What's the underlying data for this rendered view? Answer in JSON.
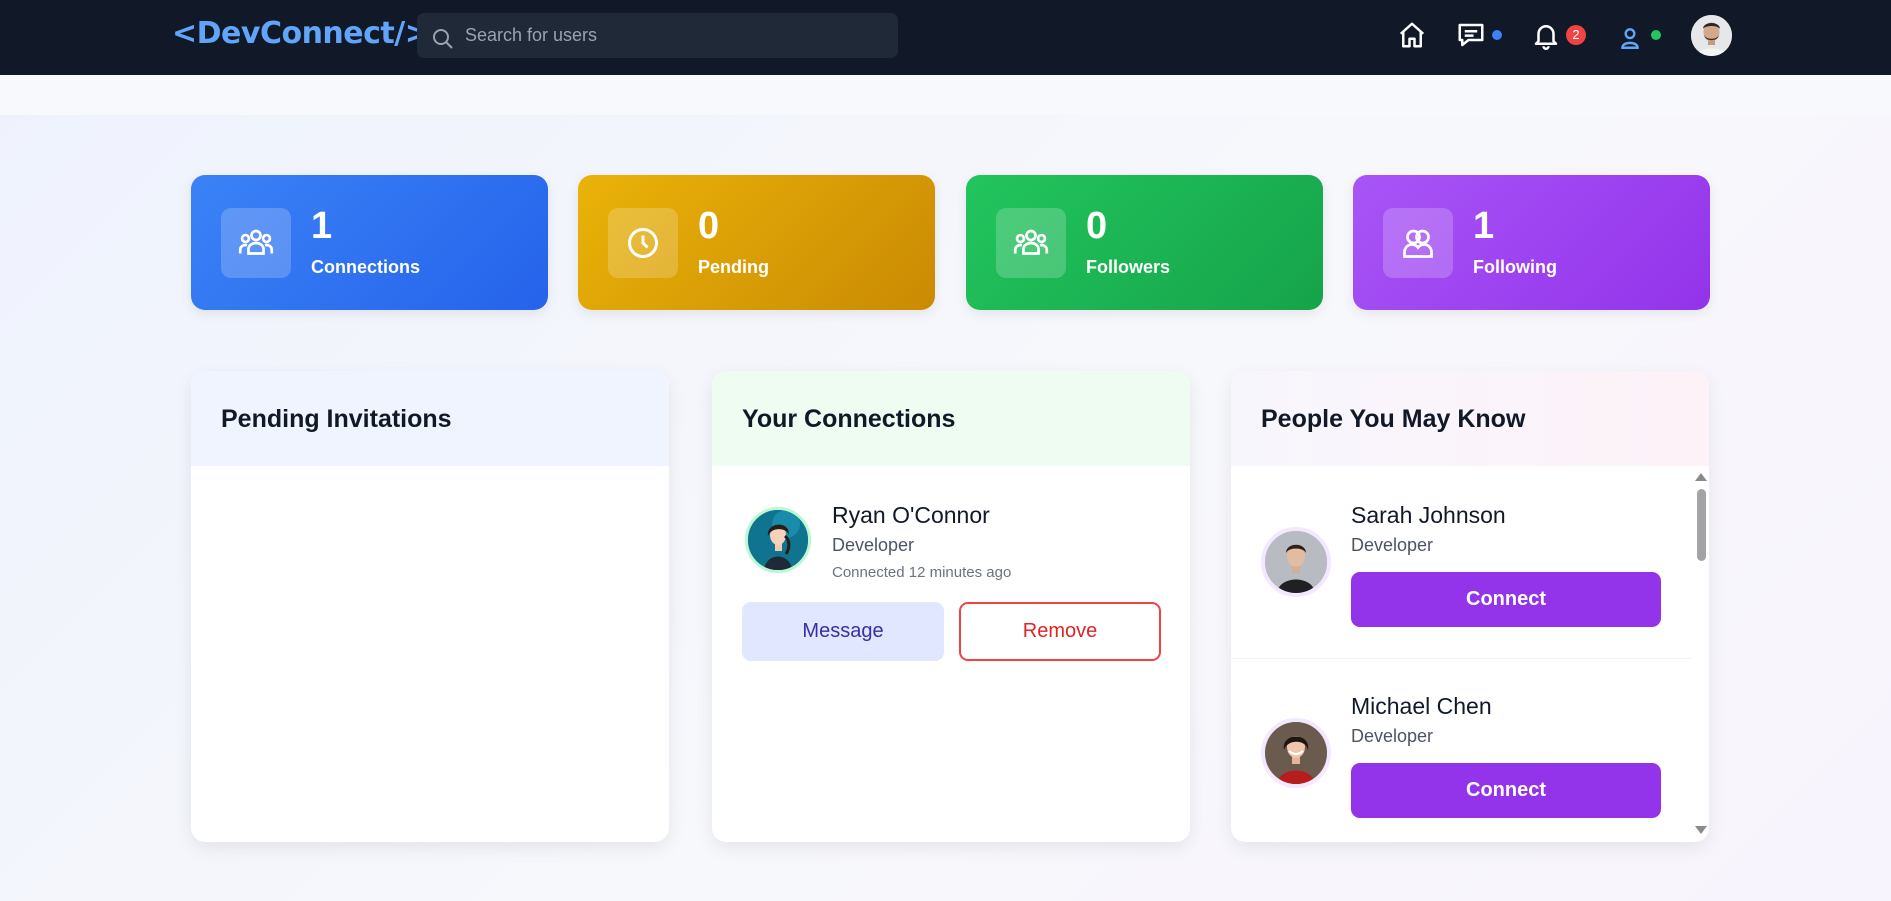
{
  "app": {
    "logo": "<DevConnect/>"
  },
  "search": {
    "placeholder": "Search for users"
  },
  "nav": {
    "icons": [
      "home-icon",
      "messages-icon",
      "bell-icon",
      "user-icon"
    ],
    "notification_count": "2",
    "colors": {
      "messages_dot": "#3b82f6",
      "user_dot": "#22c55e",
      "badge": "#ef4444"
    }
  },
  "stats": [
    {
      "value": "1",
      "label": "Connections",
      "icon": "users-icon",
      "color": "#3b82f6"
    },
    {
      "value": "0",
      "label": "Pending",
      "icon": "clock-icon",
      "color": "#eab308"
    },
    {
      "value": "0",
      "label": "Followers",
      "icon": "users-icon",
      "color": "#22c55e"
    },
    {
      "value": "1",
      "label": "Following",
      "icon": "user-group-icon",
      "color": "#a855f7"
    }
  ],
  "pending": {
    "title": "Pending Invitations"
  },
  "connections": {
    "title": "Your Connections",
    "items": [
      {
        "name": "Ryan O'Connor",
        "role": "Developer",
        "time": "Connected 12 minutes ago",
        "message_label": "Message",
        "remove_label": "Remove"
      }
    ]
  },
  "suggestions": {
    "title": "People You May Know",
    "items": [
      {
        "name": "Sarah Johnson",
        "role": "Developer",
        "connect_label": "Connect"
      },
      {
        "name": "Michael Chen",
        "role": "Developer",
        "connect_label": "Connect"
      }
    ]
  }
}
